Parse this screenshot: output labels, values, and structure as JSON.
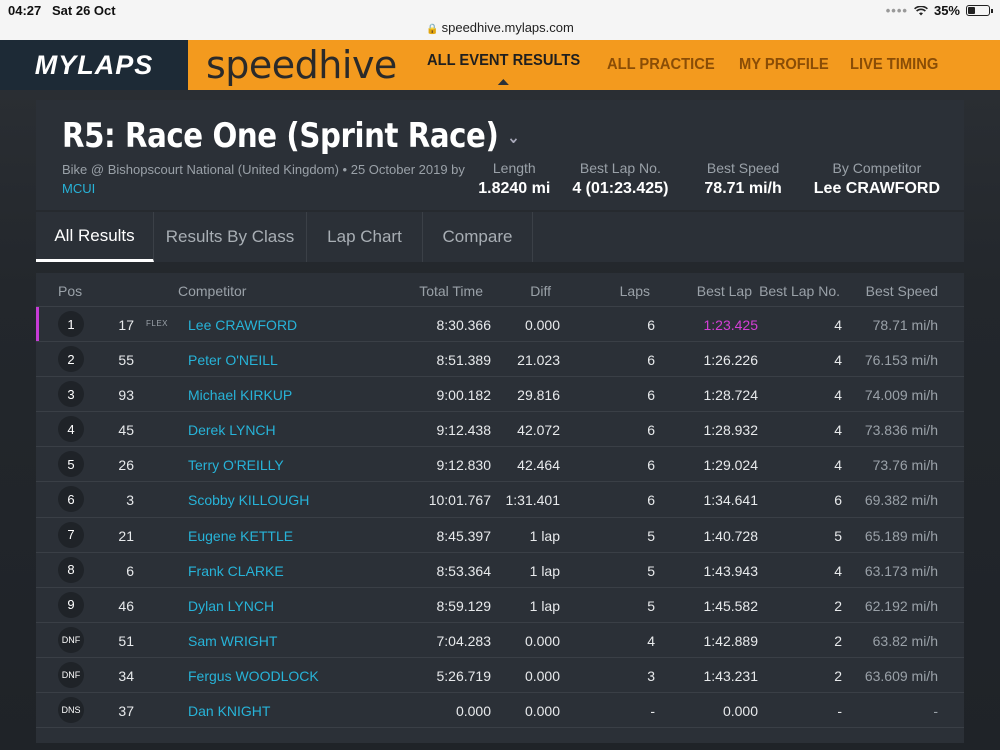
{
  "status_bar": {
    "time": "04:27",
    "date": "Sat 26 Oct",
    "url": "speedhive.mylaps.com",
    "battery": "35%"
  },
  "nav": {
    "brand": "MYLAPS",
    "product": "speedhive",
    "links": [
      "ALL EVENT RESULTS",
      "ALL PRACTICE",
      "MY PROFILE",
      "LIVE TIMING"
    ]
  },
  "event": {
    "title": "R5: Race One (Sprint Race)",
    "subtitle": "Bike @ Bishopscourt National (United Kingdom) • 25 October 2019 by",
    "organizer": "MCUI",
    "stats": [
      {
        "label": "Length",
        "value": "1.8240 mi"
      },
      {
        "label": "Best Lap No.",
        "value": "4 (01:23.425)"
      },
      {
        "label": "Best Speed",
        "value": "78.71 mi/h"
      },
      {
        "label": "By Competitor",
        "value": "Lee CRAWFORD"
      }
    ]
  },
  "tabs": [
    "All Results",
    "Results By Class",
    "Lap Chart",
    "Compare"
  ],
  "table": {
    "headers": {
      "pos": "Pos",
      "competitor": "Competitor",
      "total_time": "Total Time",
      "diff": "Diff",
      "laps": "Laps",
      "best_lap": "Best Lap",
      "best_lap_no": "Best Lap No.",
      "best_speed": "Best Speed"
    },
    "rows": [
      {
        "pos": "1",
        "num": "17",
        "tag": "FLEX",
        "name": "Lee CRAWFORD",
        "total": "8:30.366",
        "diff": "0.000",
        "laps": "6",
        "best": "1:23.425",
        "bln": "4",
        "speed": "78.71 mi/h"
      },
      {
        "pos": "2",
        "num": "55",
        "tag": "",
        "name": "Peter O'NEILL",
        "total": "8:51.389",
        "diff": "21.023",
        "laps": "6",
        "best": "1:26.226",
        "bln": "4",
        "speed": "76.153 mi/h"
      },
      {
        "pos": "3",
        "num": "93",
        "tag": "",
        "name": "Michael KIRKUP",
        "total": "9:00.182",
        "diff": "29.816",
        "laps": "6",
        "best": "1:28.724",
        "bln": "4",
        "speed": "74.009 mi/h"
      },
      {
        "pos": "4",
        "num": "45",
        "tag": "",
        "name": "Derek LYNCH",
        "total": "9:12.438",
        "diff": "42.072",
        "laps": "6",
        "best": "1:28.932",
        "bln": "4",
        "speed": "73.836 mi/h"
      },
      {
        "pos": "5",
        "num": "26",
        "tag": "",
        "name": "Terry O'REILLY",
        "total": "9:12.830",
        "diff": "42.464",
        "laps": "6",
        "best": "1:29.024",
        "bln": "4",
        "speed": "73.76 mi/h"
      },
      {
        "pos": "6",
        "num": "3",
        "tag": "",
        "name": "Scobby KILLOUGH",
        "total": "10:01.767",
        "diff": "1:31.401",
        "laps": "6",
        "best": "1:34.641",
        "bln": "6",
        "speed": "69.382 mi/h"
      },
      {
        "pos": "7",
        "num": "21",
        "tag": "",
        "name": "Eugene KETTLE",
        "total": "8:45.397",
        "diff": "1 lap",
        "laps": "5",
        "best": "1:40.728",
        "bln": "5",
        "speed": "65.189 mi/h"
      },
      {
        "pos": "8",
        "num": "6",
        "tag": "",
        "name": "Frank CLARKE",
        "total": "8:53.364",
        "diff": "1 lap",
        "laps": "5",
        "best": "1:43.943",
        "bln": "4",
        "speed": "63.173 mi/h"
      },
      {
        "pos": "9",
        "num": "46",
        "tag": "",
        "name": "Dylan LYNCH",
        "total": "8:59.129",
        "diff": "1 lap",
        "laps": "5",
        "best": "1:45.582",
        "bln": "2",
        "speed": "62.192 mi/h"
      },
      {
        "pos": "DNF",
        "num": "51",
        "tag": "",
        "name": "Sam WRIGHT",
        "total": "7:04.283",
        "diff": "0.000",
        "laps": "4",
        "best": "1:42.889",
        "bln": "2",
        "speed": "63.82 mi/h"
      },
      {
        "pos": "DNF",
        "num": "34",
        "tag": "",
        "name": "Fergus WOODLOCK",
        "total": "5:26.719",
        "diff": "0.000",
        "laps": "3",
        "best": "1:43.231",
        "bln": "2",
        "speed": "63.609 mi/h"
      },
      {
        "pos": "DNS",
        "num": "37",
        "tag": "",
        "name": "Dan KNIGHT",
        "total": "0.000",
        "diff": "0.000",
        "laps": "-",
        "best": "0.000",
        "bln": "-",
        "speed": "-"
      }
    ]
  },
  "colors": {
    "accent_orange": "#f39a1e",
    "link_blue": "#27b3d8",
    "best_lap_purple": "#d43fd6"
  }
}
